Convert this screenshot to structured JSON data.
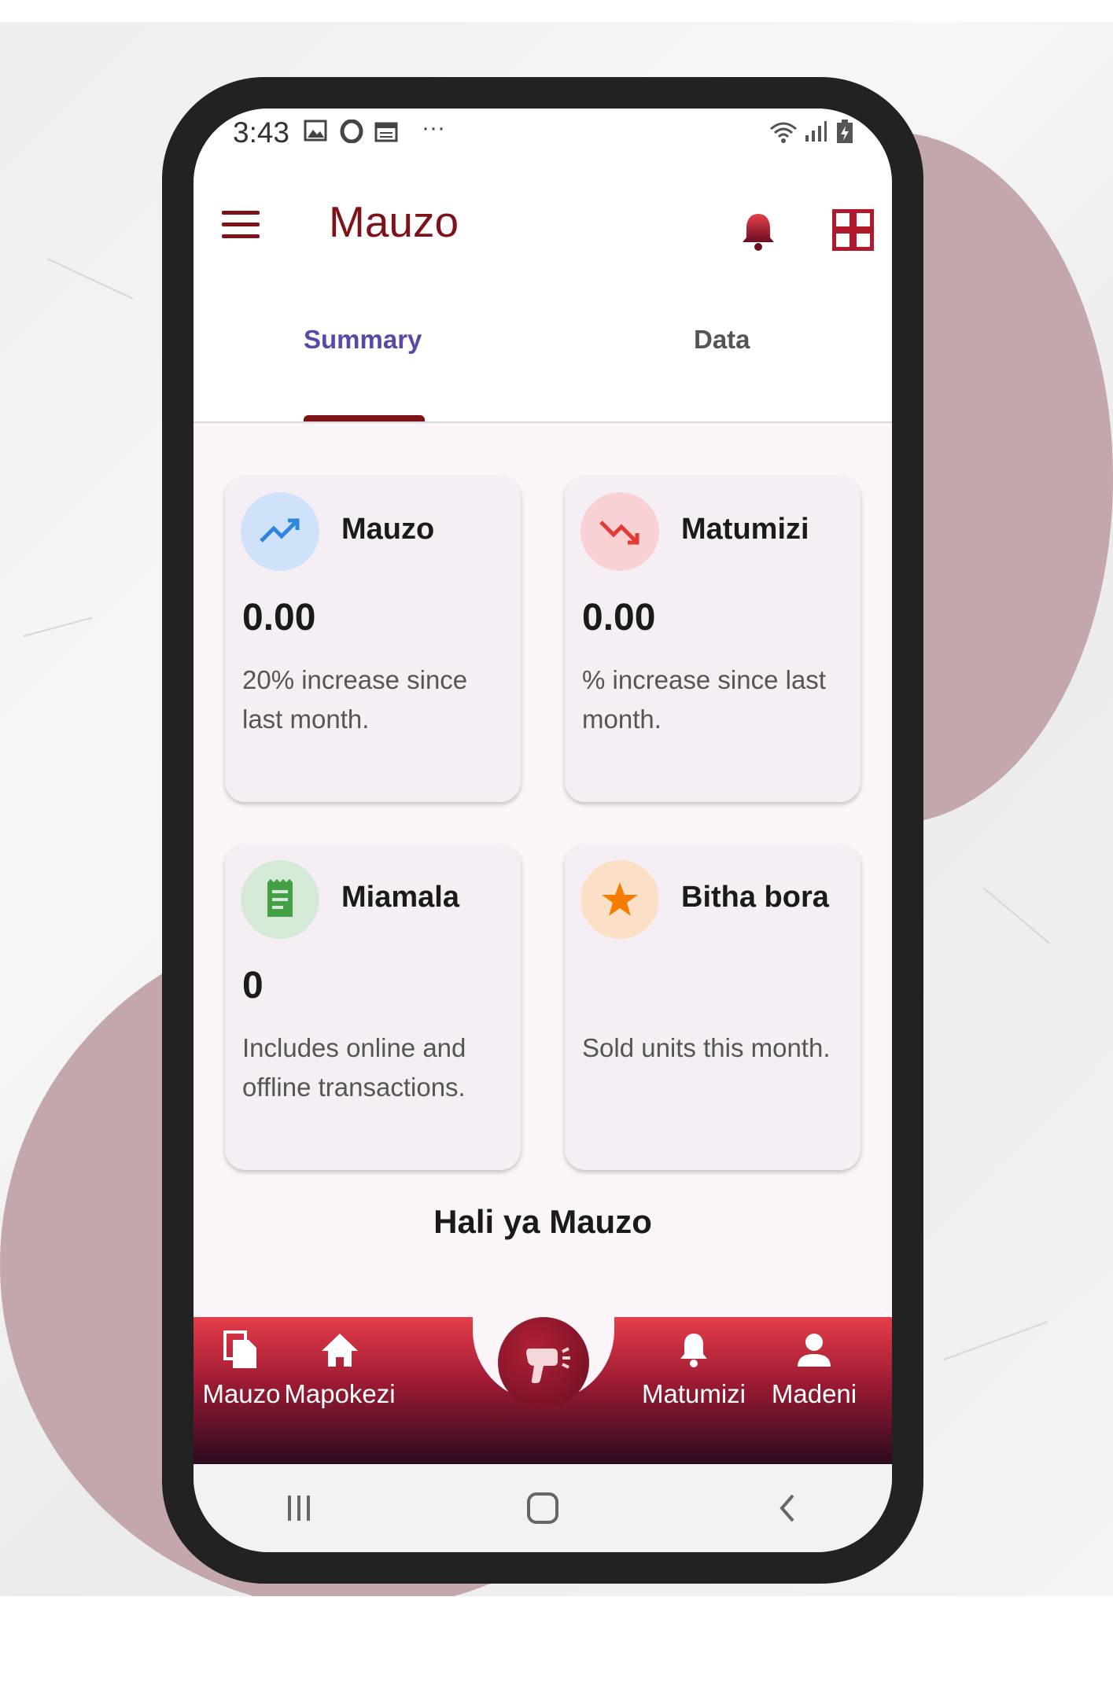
{
  "status_bar": {
    "time": "3:43",
    "dots": "···"
  },
  "app_bar": {
    "title": "Mauzo"
  },
  "tabs": [
    {
      "label": "Summary"
    },
    {
      "label": "Data"
    }
  ],
  "cards": [
    {
      "title": "Mauzo",
      "value": "0.00",
      "description": "20% increase since last month.",
      "icon": "trending-up-icon",
      "icon_bg": "#cfe2f9",
      "icon_color": "#2e86de"
    },
    {
      "title": "Matumizi",
      "value": "0.00",
      "description": "% increase since last month.",
      "icon": "trending-down-icon",
      "icon_bg": "#f7d1d4",
      "icon_color": "#e53935"
    },
    {
      "title": "Miamala",
      "value": "0",
      "description": "Includes online and offline transactions.",
      "icon": "receipt-icon",
      "icon_bg": "#d4ead6",
      "icon_color": "#43a047"
    },
    {
      "title": "Bitha bora",
      "value": "",
      "description": "Sold  units this month.",
      "icon": "star-icon",
      "icon_bg": "#fbe0c7",
      "icon_color": "#f57c00"
    }
  ],
  "section_title": "Hali ya Mauzo",
  "bottom_nav": [
    {
      "label": "Mauzo",
      "icon": "documents-icon"
    },
    {
      "label": "Mapokezi",
      "icon": "home-icon"
    },
    {
      "label": "Matumizi",
      "icon": "bell-icon"
    },
    {
      "label": "Madeni",
      "icon": "person-icon"
    }
  ],
  "colors": {
    "brand": "#7d1218",
    "tab_active": "#5a48a8",
    "background_blob": "#c3a7ab",
    "nav_gradient_top": "#e63d4a",
    "nav_gradient_bottom": "#2c0a20"
  }
}
